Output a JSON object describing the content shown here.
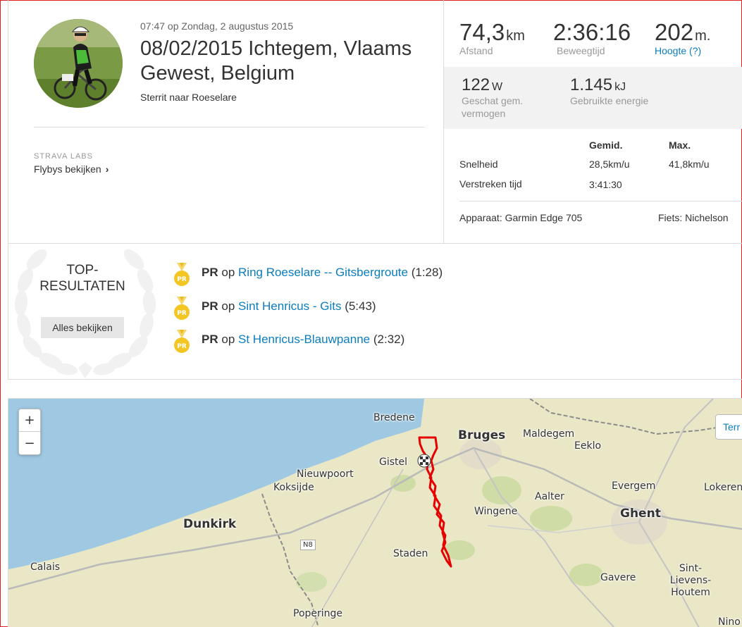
{
  "activity": {
    "datetime": "07:47 op Zondag, 2 augustus 2015",
    "title": "08/02/2015 Ichtegem, Vlaams Gewest, Belgium",
    "description": "Sterrit naar Roeselare",
    "labs_caption": "STRAVA LABS",
    "flyby_link": "Flybys bekijken"
  },
  "stats": {
    "distance": {
      "value": "74,3",
      "unit": "km",
      "label": "Afstand"
    },
    "moving_time": {
      "value": "2:36:16",
      "label": "Beweegtijd"
    },
    "elevation": {
      "value": "202",
      "unit": "m.",
      "label": "Hoogte (?)"
    },
    "power": {
      "value": "122",
      "unit": "W",
      "label": "Geschat gem. vermogen"
    },
    "energy": {
      "value": "1.145",
      "unit": "kJ",
      "label": "Gebruikte energie"
    }
  },
  "table": {
    "col_avg": "Gemid.",
    "col_max": "Max.",
    "rows": [
      {
        "label": "Snelheid",
        "avg": "28,5km/u",
        "max": "41,8km/u"
      },
      {
        "label": "Verstreken tijd",
        "avg": "3:41:30",
        "max": ""
      }
    ]
  },
  "device": "Apparaat: Garmin Edge 705",
  "bike": "Fiets: Nichelson",
  "top_results": {
    "title": "TOP-RESULTATEN",
    "title_line1": "TOP-",
    "title_line2": "RESULTATEN",
    "button": "Alles bekijken",
    "items": [
      {
        "badge": "PR",
        "prefix": "PR",
        "op": "op",
        "segment": "Ring Roeselare -- Gitsbergroute",
        "time": "(1:28)"
      },
      {
        "badge": "PR",
        "prefix": "PR",
        "op": "op",
        "segment": "Sint Henricus - Gits",
        "time": "(5:43)"
      },
      {
        "badge": "PR",
        "prefix": "PR",
        "op": "op",
        "segment": "St Henricus-Blauwpanne",
        "time": "(2:32)"
      }
    ]
  },
  "map": {
    "zoom_in": "+",
    "zoom_out": "−",
    "terrain_button": "Terr",
    "road_shield": "N8",
    "places": [
      "Bredene",
      "Bruges",
      "Maldegem",
      "Eeklo",
      "Gistel",
      "Nieuwpoort",
      "Koksijde",
      "Evergem",
      "Lokeren",
      "Aalter",
      "Wingene",
      "Ghent",
      "Dunkirk",
      "Staden",
      "Calais",
      "Gavere",
      "Sint-Lievens-Houtem",
      "Poperinge",
      "Nino"
    ],
    "colors": {
      "sea": "#9fc9e2",
      "land": "#e9e7c6",
      "route": "#e60000",
      "forest": "#c9d8a0"
    }
  }
}
